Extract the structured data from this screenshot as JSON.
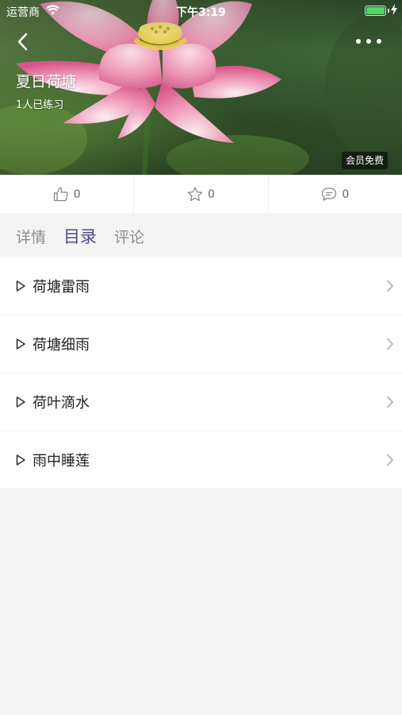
{
  "status": {
    "carrier": "运营商",
    "time": "下午3:19",
    "battery_level": 1.0
  },
  "header": {
    "title": "夏日荷塘",
    "subtitle": "1人已练习",
    "badge": "会员免费",
    "icons": {
      "back": "chevron-left-icon",
      "more": "more-dots-icon"
    }
  },
  "actions": [
    {
      "icon": "thumbs-up-icon",
      "count": "0"
    },
    {
      "icon": "star-icon",
      "count": "0"
    },
    {
      "icon": "comment-icon",
      "count": "0"
    }
  ],
  "tabs": [
    {
      "label": "详情",
      "active": false
    },
    {
      "label": "目录",
      "active": true
    },
    {
      "label": "评论",
      "active": false
    }
  ],
  "tracks": [
    {
      "title": "荷塘雷雨"
    },
    {
      "title": "荷塘细雨"
    },
    {
      "title": "荷叶滴水"
    },
    {
      "title": "雨中睡莲"
    }
  ],
  "colors": {
    "accent": "#4b4b8c",
    "battery": "#4cd964",
    "background": "#f4f4f4"
  }
}
